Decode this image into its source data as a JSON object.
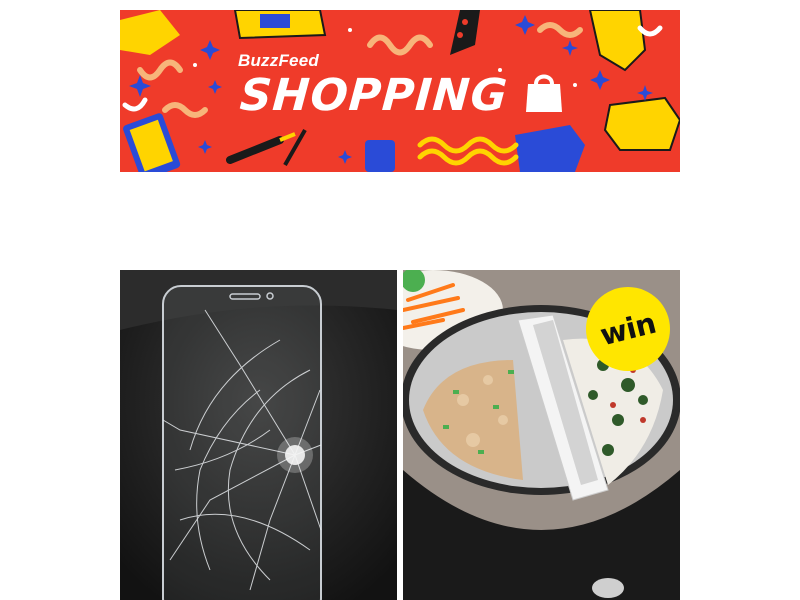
{
  "banner": {
    "brand": "BuzzFeed",
    "title": "SHOPPING",
    "bag_icon": "shopping-bag-icon",
    "background_color": "#ef3b2a"
  },
  "products": [
    {
      "image": "cracked-glass-screen-protector-photo",
      "badge": ""
    },
    {
      "image": "slow-cooker-divider-liner-dip-photo",
      "badge": "win",
      "badge_color": "#ffe600"
    }
  ]
}
